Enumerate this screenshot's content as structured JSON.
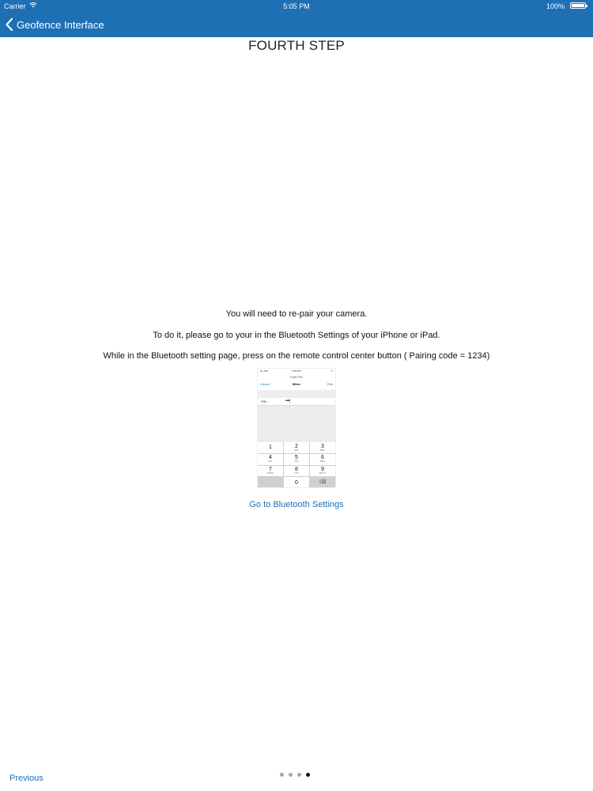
{
  "status_bar": {
    "carrier": "Carrier",
    "time": "5:05 PM",
    "battery": "100%"
  },
  "nav": {
    "back_label": "Geofence Interface"
  },
  "title": "FOURTH STEP",
  "messages": [
    "You will need to re-pair your camera.",
    "To do it, please go to your in the Bluetooth Settings of your iPhone or iPad.",
    "While in the Bluetooth setting page, press on the remote control center button ( Pairing code = 1234)"
  ],
  "phone_image": {
    "status_left": "No SIM",
    "status_time": "5:56 PM",
    "status_right": "∗",
    "prompt": "Enter PIN",
    "cancel": "Cancel",
    "device": "Mitec",
    "pair": "Pair",
    "pin_label": "PIN",
    "pin_value": "••••|",
    "keys": [
      {
        "digit": "1",
        "letters": ""
      },
      {
        "digit": "2",
        "letters": "ABC"
      },
      {
        "digit": "3",
        "letters": "DEF"
      },
      {
        "digit": "4",
        "letters": "GHI"
      },
      {
        "digit": "5",
        "letters": "JKL"
      },
      {
        "digit": "6",
        "letters": "MNO"
      },
      {
        "digit": "7",
        "letters": "PQRS"
      },
      {
        "digit": "8",
        "letters": "TUV"
      },
      {
        "digit": "9",
        "letters": "WXYZ"
      },
      {
        "digit": "",
        "letters": ""
      },
      {
        "digit": "0",
        "letters": ""
      },
      {
        "digit": "⌫",
        "letters": ""
      }
    ]
  },
  "bluetooth_link": "Go to Bluetooth Settings",
  "pager": {
    "total": 4,
    "current": 4
  },
  "previous_label": "Previous",
  "colors": {
    "nav_bar": "#1f6fb4",
    "link": "#1f6fb4"
  }
}
